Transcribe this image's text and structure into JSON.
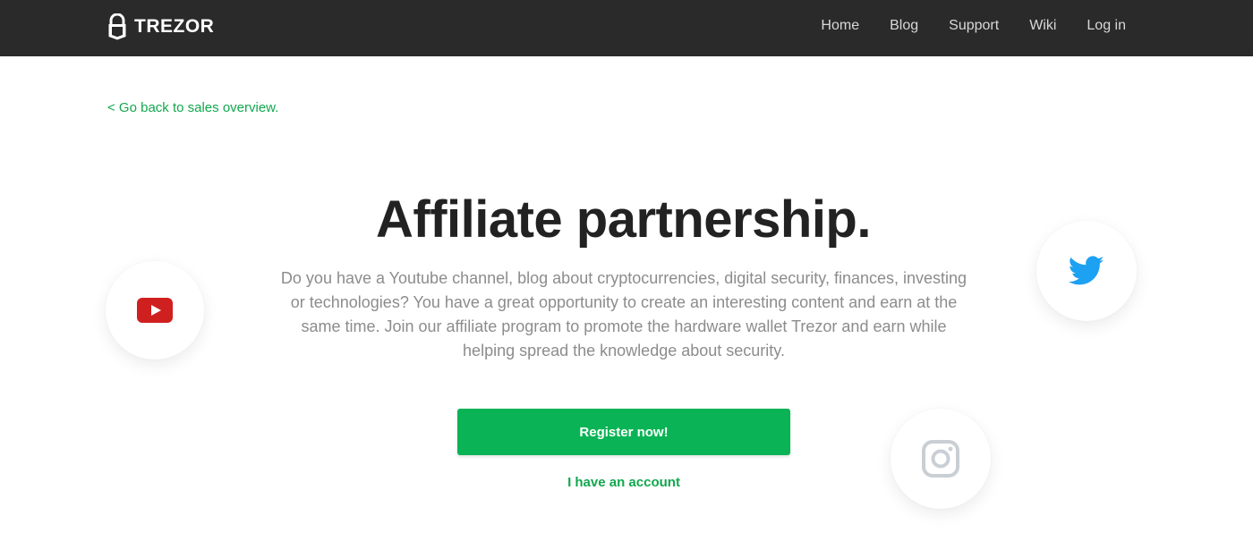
{
  "header": {
    "brand": "TREZOR",
    "nav": {
      "home": "Home",
      "blog": "Blog",
      "support": "Support",
      "wiki": "Wiki",
      "login": "Log in"
    }
  },
  "main": {
    "back_link": "< Go back to sales overview.",
    "title": "Affiliate partnership.",
    "description": "Do you have a Youtube channel, blog about cryptocurrencies, digital security, finances, investing or technologies? You have a great opportunity to create an interesting content and earn at the same time. Join our affiliate program to promote the hardware wallet Trezor and earn while helping spread the knowledge about security.",
    "register_button": "Register now!",
    "account_link": "I have an account"
  },
  "social_icons": [
    "youtube-icon",
    "twitter-icon",
    "instagram-icon"
  ],
  "colors": {
    "header_bg": "#2a2a2a",
    "accent_green": "#0ab355",
    "link_green": "#11a84e",
    "youtube_red": "#d01f1f",
    "twitter_blue": "#1da1f2",
    "instagram_gray": "#c9cfd4"
  }
}
